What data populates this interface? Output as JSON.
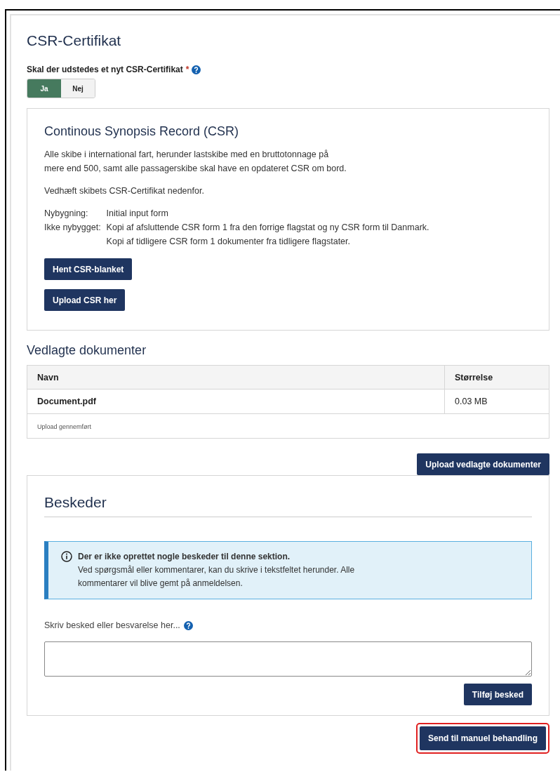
{
  "section_title": "CSR-Certifikat",
  "question": {
    "label": "Skal der udstedes et nyt CSR-Certifikat",
    "required_mark": "*",
    "options": [
      {
        "label": "Ja",
        "selected": true
      },
      {
        "label": "Nej",
        "selected": false
      }
    ]
  },
  "info_card": {
    "title": "Continous Synopsis Record (CSR)",
    "paragraphs": [
      [
        "Alle skibe i international fart, herunder lastskibe med en bruttotonnage på",
        "mere end 500, samt alle passagerskibe skal have en opdateret CSR om bord."
      ],
      [
        "Vedhæft skibets CSR-Certifikat nedenfor."
      ]
    ],
    "definitions": [
      {
        "term": "Nybygning:",
        "lines": [
          "Initial input form"
        ]
      },
      {
        "term": "Ikke nybygget:",
        "lines": [
          "Kopi af afsluttende CSR form 1 fra den forrige flagstat og ny CSR form til Danmark.",
          "Kopi af tidligere CSR form 1 dokumenter fra tidligere flagstater."
        ]
      }
    ],
    "buttons": [
      "Hent CSR-blanket",
      "Upload CSR her"
    ]
  },
  "documents": {
    "title": "Vedlagte dokumenter",
    "columns": [
      "Navn",
      "Størrelse"
    ],
    "rows": [
      {
        "name": "Document.pdf",
        "size": "0.03 MB"
      }
    ],
    "status": "Upload gennemført",
    "upload_button": "Upload vedlagte dokumenter"
  },
  "messages": {
    "title": "Beskeder",
    "alert": {
      "title": "Der er ikke oprettet nogle beskeder til denne sektion.",
      "lines": [
        "Ved spørgsmål eller kommentarer, kan du skrive i tekstfeltet herunder. Alle",
        "kommentarer vil blive gemt på anmeldelsen."
      ]
    },
    "input_label": "Skriv besked eller besvarelse her...",
    "add_button": "Tilføj besked"
  },
  "submit_button": {
    "label": "Send til manuel behandling",
    "highlighted": true
  }
}
